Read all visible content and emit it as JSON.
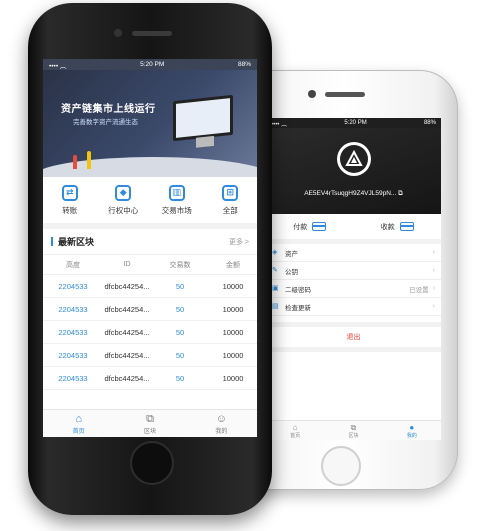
{
  "colors": {
    "accent": "#2f8cdc",
    "logout": "#e53935"
  },
  "front": {
    "status": {
      "time": "5:20 PM",
      "battery": "88%"
    },
    "banner": {
      "title": "资产链集市上线运行",
      "subtitle": "完善数字资产流通生态"
    },
    "quick": [
      {
        "label": "转账",
        "icon": "transfer-icon"
      },
      {
        "label": "行权中心",
        "icon": "shield-icon"
      },
      {
        "label": "交易市场",
        "icon": "market-icon"
      },
      {
        "label": "全部",
        "icon": "grid-icon"
      }
    ],
    "section": {
      "title": "最新区块",
      "more": "更多 >"
    },
    "columns": [
      "高度",
      "ID",
      "交易数",
      "金额"
    ],
    "rows": [
      {
        "h": "2204533",
        "id": "dfcbc44254...",
        "n": "50",
        "amt": "10000"
      },
      {
        "h": "2204533",
        "id": "dfcbc44254...",
        "n": "50",
        "amt": "10000"
      },
      {
        "h": "2204533",
        "id": "dfcbc44254...",
        "n": "50",
        "amt": "10000"
      },
      {
        "h": "2204533",
        "id": "dfcbc44254...",
        "n": "50",
        "amt": "10000"
      },
      {
        "h": "2204533",
        "id": "dfcbc44254...",
        "n": "50",
        "amt": "10000"
      }
    ],
    "tabs": [
      {
        "label": "首页",
        "icon": "home-icon"
      },
      {
        "label": "区块",
        "icon": "blocks-icon"
      },
      {
        "label": "我的",
        "icon": "user-icon"
      }
    ]
  },
  "back": {
    "status": {
      "time": "5:20 PM",
      "battery": "88%"
    },
    "address": "AE5EV4rTsuqgH9Z4VJL59pN... ⧉",
    "pay": "付款",
    "receive": "收款",
    "menu": [
      {
        "label": "资产",
        "value": "",
        "icon": "wallet-icon"
      },
      {
        "label": "公钥",
        "value": "",
        "icon": "key-icon"
      },
      {
        "label": "二级密码",
        "value": "已设置",
        "icon": "lock-icon"
      },
      {
        "label": "检查更新",
        "value": "",
        "icon": "update-icon"
      }
    ],
    "logout": "退出",
    "tabs": [
      {
        "label": "首页",
        "icon": "home-icon"
      },
      {
        "label": "区块",
        "icon": "blocks-icon"
      },
      {
        "label": "我的",
        "icon": "user-icon"
      }
    ]
  }
}
